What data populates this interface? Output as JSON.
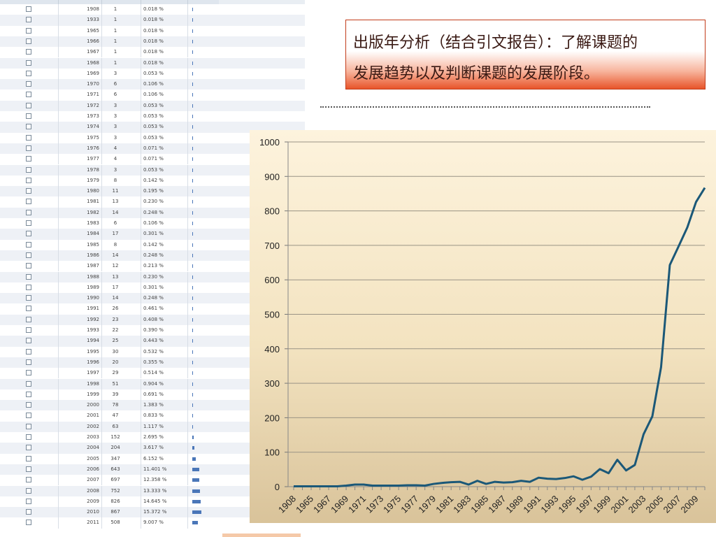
{
  "table": {
    "rows": [
      {
        "year": "1908",
        "count": "1",
        "percent": "0.018 %",
        "frac": 0.018
      },
      {
        "year": "1933",
        "count": "1",
        "percent": "0.018 %",
        "frac": 0.018
      },
      {
        "year": "1965",
        "count": "1",
        "percent": "0.018 %",
        "frac": 0.018
      },
      {
        "year": "1966",
        "count": "1",
        "percent": "0.018 %",
        "frac": 0.018
      },
      {
        "year": "1967",
        "count": "1",
        "percent": "0.018 %",
        "frac": 0.018
      },
      {
        "year": "1968",
        "count": "1",
        "percent": "0.018 %",
        "frac": 0.018
      },
      {
        "year": "1969",
        "count": "3",
        "percent": "0.053 %",
        "frac": 0.053
      },
      {
        "year": "1970",
        "count": "6",
        "percent": "0.106 %",
        "frac": 0.106
      },
      {
        "year": "1971",
        "count": "6",
        "percent": "0.106 %",
        "frac": 0.106
      },
      {
        "year": "1972",
        "count": "3",
        "percent": "0.053 %",
        "frac": 0.053
      },
      {
        "year": "1973",
        "count": "3",
        "percent": "0.053 %",
        "frac": 0.053
      },
      {
        "year": "1974",
        "count": "3",
        "percent": "0.053 %",
        "frac": 0.053
      },
      {
        "year": "1975",
        "count": "3",
        "percent": "0.053 %",
        "frac": 0.053
      },
      {
        "year": "1976",
        "count": "4",
        "percent": "0.071 %",
        "frac": 0.071
      },
      {
        "year": "1977",
        "count": "4",
        "percent": "0.071 %",
        "frac": 0.071
      },
      {
        "year": "1978",
        "count": "3",
        "percent": "0.053 %",
        "frac": 0.053
      },
      {
        "year": "1979",
        "count": "8",
        "percent": "0.142 %",
        "frac": 0.142
      },
      {
        "year": "1980",
        "count": "11",
        "percent": "0.195 %",
        "frac": 0.195
      },
      {
        "year": "1981",
        "count": "13",
        "percent": "0.230 %",
        "frac": 0.23
      },
      {
        "year": "1982",
        "count": "14",
        "percent": "0.248 %",
        "frac": 0.248
      },
      {
        "year": "1983",
        "count": "6",
        "percent": "0.106 %",
        "frac": 0.106
      },
      {
        "year": "1984",
        "count": "17",
        "percent": "0.301 %",
        "frac": 0.301
      },
      {
        "year": "1985",
        "count": "8",
        "percent": "0.142 %",
        "frac": 0.142
      },
      {
        "year": "1986",
        "count": "14",
        "percent": "0.248 %",
        "frac": 0.248
      },
      {
        "year": "1987",
        "count": "12",
        "percent": "0.213 %",
        "frac": 0.213
      },
      {
        "year": "1988",
        "count": "13",
        "percent": "0.230 %",
        "frac": 0.23
      },
      {
        "year": "1989",
        "count": "17",
        "percent": "0.301 %",
        "frac": 0.301
      },
      {
        "year": "1990",
        "count": "14",
        "percent": "0.248 %",
        "frac": 0.248
      },
      {
        "year": "1991",
        "count": "26",
        "percent": "0.461 %",
        "frac": 0.461
      },
      {
        "year": "1992",
        "count": "23",
        "percent": "0.408 %",
        "frac": 0.408
      },
      {
        "year": "1993",
        "count": "22",
        "percent": "0.390 %",
        "frac": 0.39
      },
      {
        "year": "1994",
        "count": "25",
        "percent": "0.443 %",
        "frac": 0.443
      },
      {
        "year": "1995",
        "count": "30",
        "percent": "0.532 %",
        "frac": 0.532
      },
      {
        "year": "1996",
        "count": "20",
        "percent": "0.355 %",
        "frac": 0.355
      },
      {
        "year": "1997",
        "count": "29",
        "percent": "0.514 %",
        "frac": 0.514
      },
      {
        "year": "1998",
        "count": "51",
        "percent": "0.904 %",
        "frac": 0.904
      },
      {
        "year": "1999",
        "count": "39",
        "percent": "0.691 %",
        "frac": 0.691
      },
      {
        "year": "2000",
        "count": "78",
        "percent": "1.383 %",
        "frac": 1.383
      },
      {
        "year": "2001",
        "count": "47",
        "percent": "0.833 %",
        "frac": 0.833
      },
      {
        "year": "2002",
        "count": "63",
        "percent": "1.117 %",
        "frac": 1.117
      },
      {
        "year": "2003",
        "count": "152",
        "percent": "2.695 %",
        "frac": 2.695
      },
      {
        "year": "2004",
        "count": "204",
        "percent": "3.617 %",
        "frac": 3.617
      },
      {
        "year": "2005",
        "count": "347",
        "percent": "6.152 %",
        "frac": 6.152
      },
      {
        "year": "2006",
        "count": "643",
        "percent": "11.401 %",
        "frac": 11.401
      },
      {
        "year": "2007",
        "count": "697",
        "percent": "12.358 %",
        "frac": 12.358
      },
      {
        "year": "2008",
        "count": "752",
        "percent": "13.333 %",
        "frac": 13.333
      },
      {
        "year": "2009",
        "count": "826",
        "percent": "14.645 %",
        "frac": 14.645
      },
      {
        "year": "2010",
        "count": "867",
        "percent": "15.372 %",
        "frac": 15.372
      },
      {
        "year": "2011",
        "count": "508",
        "percent": "9.007 %",
        "frac": 9.007
      }
    ]
  },
  "note": {
    "line1": "出版年分析（结合引文报告）：了解课题的",
    "line2": "发展趋势以及判断课题的发展阶段。"
  },
  "chart_data": {
    "type": "line",
    "x": [
      "1908",
      "1933",
      "1965",
      "1966",
      "1967",
      "1968",
      "1969",
      "1970",
      "1971",
      "1972",
      "1973",
      "1974",
      "1975",
      "1976",
      "1977",
      "1978",
      "1979",
      "1980",
      "1981",
      "1982",
      "1983",
      "1984",
      "1985",
      "1986",
      "1987",
      "1988",
      "1989",
      "1990",
      "1991",
      "1992",
      "1993",
      "1994",
      "1995",
      "1996",
      "1997",
      "1998",
      "1999",
      "2000",
      "2001",
      "2002",
      "2003",
      "2004",
      "2005",
      "2006",
      "2007",
      "2008",
      "2009",
      "2010"
    ],
    "tick_labels": [
      "1908",
      "1965",
      "1967",
      "1969",
      "1971",
      "1973",
      "1975",
      "1977",
      "1979",
      "1981",
      "1983",
      "1985",
      "1987",
      "1989",
      "1991",
      "1993",
      "1995",
      "1997",
      "1999",
      "2001",
      "2003",
      "2005",
      "2007",
      "2009"
    ],
    "series": [
      {
        "values": [
          1,
          1,
          1,
          1,
          1,
          1,
          3,
          6,
          6,
          3,
          3,
          3,
          3,
          4,
          4,
          3,
          8,
          11,
          13,
          14,
          6,
          17,
          8,
          14,
          12,
          13,
          17,
          14,
          26,
          23,
          22,
          25,
          30,
          20,
          29,
          51,
          39,
          78,
          47,
          63,
          152,
          204,
          347,
          643,
          697,
          752,
          826,
          867
        ]
      }
    ],
    "yticks": [
      0,
      100,
      200,
      300,
      400,
      500,
      600,
      700,
      800,
      900,
      1000
    ],
    "ylim": [
      0,
      1000
    ],
    "grid": true,
    "line_color": "#1b5878"
  }
}
